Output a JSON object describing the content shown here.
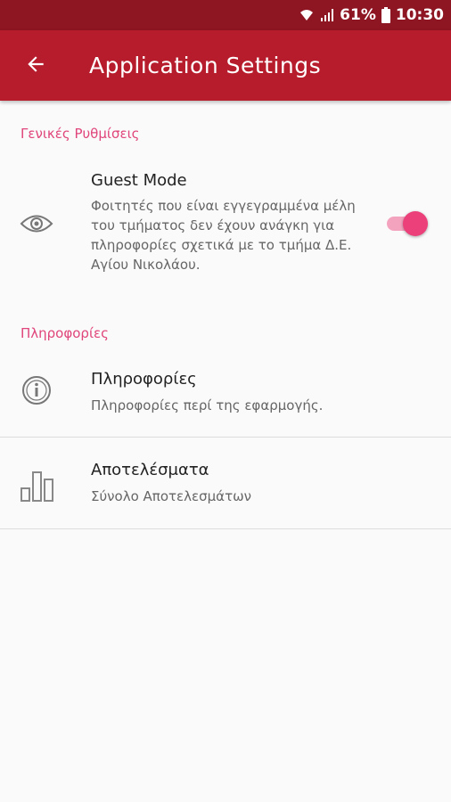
{
  "status_bar": {
    "battery": "61%",
    "time": "10:30"
  },
  "app_bar": {
    "title": "Application Settings"
  },
  "sections": {
    "general": {
      "header": "Γενικές Ρυθμίσεις",
      "guest_mode": {
        "title": "Guest Mode",
        "summary": "Φοιτητές που είναι εγγεγραμμένα μέλη του τμήματος δεν έχουν ανάγκη για πληροφορίες σχετικά με το τμήμα Δ.Ε. Αγίου Νικολάου.",
        "enabled": true,
        "icon": "eye-icon"
      }
    },
    "info": {
      "header": "Πληροφορίες",
      "information": {
        "title": "Πληροφορίες",
        "summary": "Πληροφορίες περί της εφαρμογής.",
        "icon": "info-icon"
      },
      "results": {
        "title": "Αποτελέσματα",
        "summary": "Σύνολο Αποτελεσμάτων",
        "icon": "bar-chart-icon"
      }
    }
  },
  "colors": {
    "status_bar": "#8e1522",
    "app_bar": "#b71c2c",
    "accent": "#ec407a",
    "section_header": "#e0457b"
  }
}
